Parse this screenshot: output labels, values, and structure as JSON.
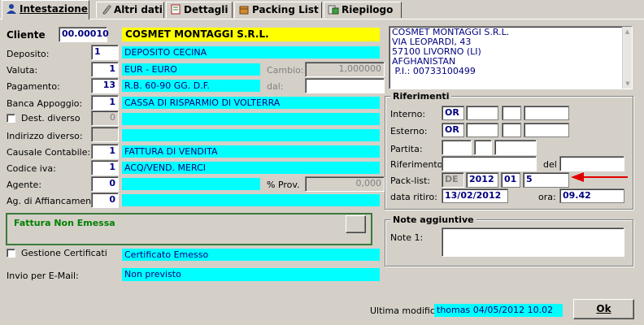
{
  "tabs": [
    {
      "label": "Intestazione"
    },
    {
      "label": "Altri dati"
    },
    {
      "label": "Dettagli"
    },
    {
      "label": "Packing List"
    },
    {
      "label": "Riepilogo"
    }
  ],
  "cliente": {
    "label": "Cliente",
    "code": "00.00010",
    "name": "COSMET MONTAGGI S.R.L."
  },
  "address": {
    "lines": [
      "COSMET MONTAGGI S.R.L.",
      "VIA LEOPARDI, 43",
      "57100 LIVORNO (LI)",
      "AFGHANISTAN",
      " P.I.: 00733100499"
    ]
  },
  "deposito": {
    "label": "Deposito:",
    "value": "1",
    "text": "DEPOSITO CECINA"
  },
  "valuta": {
    "label": "Valuta:",
    "value": "1",
    "text": "EUR - EURO",
    "cambio_label": "Cambio:",
    "cambio": "1,000000"
  },
  "pagamento": {
    "label": "Pagamento:",
    "value": "13",
    "text": "R.B. 60-90 GG. D.F.",
    "dal_label": "dal:"
  },
  "banca": {
    "label": "Banca Appoggio:",
    "value": "1",
    "text": "CASSA DI RISPARMIO DI VOLTERRA"
  },
  "dest": {
    "label": "Dest. diverso",
    "value": "0"
  },
  "indirizzo": {
    "label": "Indirizzo diverso:"
  },
  "causale": {
    "label": "Causale Contabile:",
    "value": "1",
    "text": "FATTURA DI VENDITA"
  },
  "iva": {
    "label": "Codice iva:",
    "value": "1",
    "text": "ACQ/VEND. MERCI"
  },
  "agente": {
    "label": "Agente:",
    "value": "0",
    "prov_label": "% Prov.",
    "prov": "0,000"
  },
  "affiancamento": {
    "label": "Ag. di Affiancamento:",
    "value": "0"
  },
  "fattura": {
    "status": "Fattura Non Emessa"
  },
  "certificati": {
    "label": "Gestione Certificati",
    "value": "Certificato Emesso"
  },
  "email": {
    "label": "Invio per E-Mail:",
    "value": "Non previsto"
  },
  "riferimenti": {
    "title": "Riferimenti",
    "interno_label": "Interno:",
    "interno": "OR",
    "esterno_label": "Esterno:",
    "esterno": "OR",
    "partita_label": "Partita:",
    "riferimento_label": "Riferimento:",
    "del_label": "del",
    "packlist_label": "Pack-list:",
    "pl_type": "DE",
    "pl_year": "2012",
    "pl_series": "01",
    "pl_num": "5",
    "ritiro_label": "data ritiro:",
    "ritiro": "13/02/2012",
    "ora_label": "ora:",
    "ora": "09.42"
  },
  "note": {
    "title": "Note aggiuntive",
    "label": "Note 1:"
  },
  "footer": {
    "label": "Ultima modifica",
    "value": "thomas 04/05/2012 10.02",
    "ok": "Ok"
  },
  "colors": {
    "accent_cyan": "#00ffff",
    "accent_yellow": "#ffff00",
    "text_navy": "#000080",
    "status_green": "#008000",
    "arrow_red": "#e00000"
  }
}
